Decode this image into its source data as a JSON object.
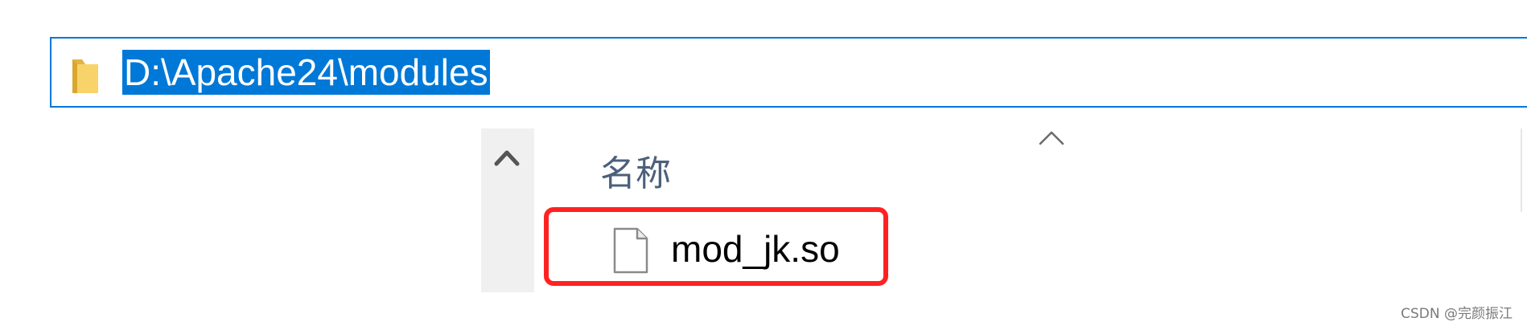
{
  "address_bar": {
    "path": "D:\\Apache24\\modules",
    "icon": "folder-icon"
  },
  "navigation_pane": {
    "scroll_icon": "chevron-up-icon"
  },
  "file_list": {
    "sort_indicator_icon": "chevron-up-icon",
    "columns": [
      {
        "label": "名称"
      }
    ],
    "rows": [
      {
        "name": "mod_jk.so",
        "icon": "file-icon",
        "highlighted": true
      }
    ]
  },
  "colors": {
    "selection": "#0078d7",
    "highlight_border": "#ff2222",
    "header_text": "#4c607a"
  },
  "watermark": "CSDN @完颜振江"
}
